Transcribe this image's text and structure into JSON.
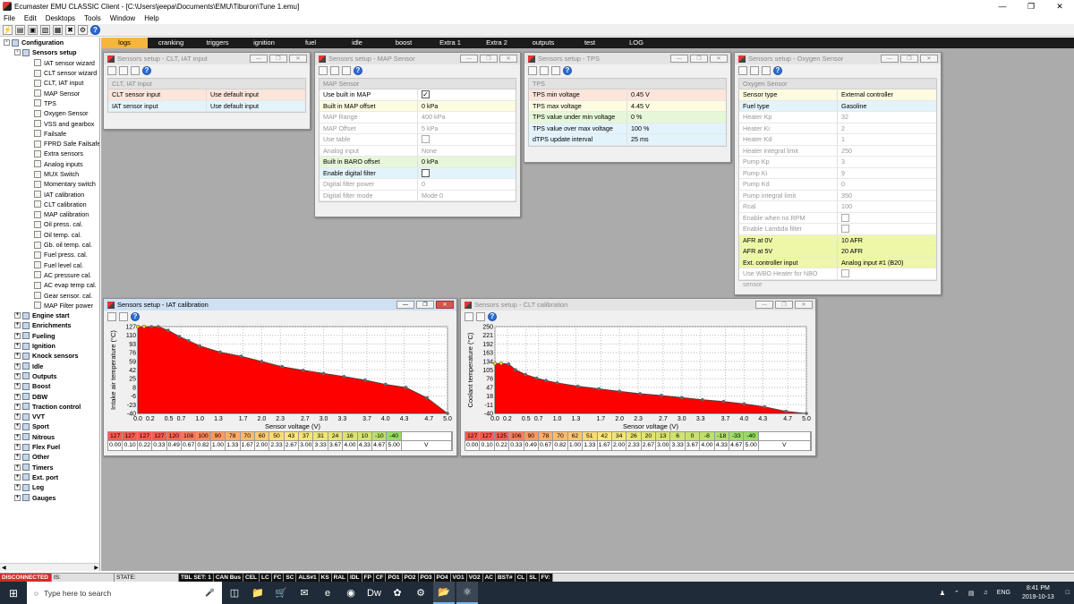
{
  "app": {
    "title": "Ecumaster EMU CLASSIC Client - [C:\\Users\\jeepa\\Documents\\EMU\\Tiburon\\Tune 1.emu]"
  },
  "menu": [
    "File",
    "Edit",
    "Desktops",
    "Tools",
    "Window",
    "Help"
  ],
  "tree": {
    "root": "Configuration",
    "sensors_setup": "Sensors setup",
    "children": [
      "IAT sensor wizard",
      "CLT sensor wizard",
      "CLT, IAT input",
      "MAP Sensor",
      "TPS",
      "Oxygen Sensor",
      "VSS and gearbox",
      "Failsafe",
      "FPRD Safe Failsafe",
      "Extra sensors",
      "Analog inputs",
      "MUX Switch",
      "Momentary switch",
      "IAT calibration",
      "CLT calibration",
      "MAP calibration",
      "Oil press. cal.",
      "Oil temp. cal.",
      "Gb. oil temp. cal.",
      "Fuel press. cal.",
      "Fuel level cal.",
      "AC pressure cal.",
      "AC evap temp cal.",
      "Gear sensor. cal.",
      "MAP Filter power"
    ],
    "groups": [
      "Engine start",
      "Enrichments",
      "Fueling",
      "Ignition",
      "Knock sensors",
      "Idle",
      "Outputs",
      "Boost",
      "DBW",
      "Traction control",
      "VVT",
      "Sport",
      "Nitrous",
      "Flex Fuel",
      "Other",
      "Timers",
      "Ext. port",
      "Log",
      "Gauges"
    ]
  },
  "tabs": [
    "logs",
    "cranking",
    "triggers",
    "ignition",
    "fuel",
    "idle",
    "boost",
    "Extra 1",
    "Extra 2",
    "outputs",
    "test",
    "LOG"
  ],
  "active_tab": "logs",
  "clt_iat_window": {
    "title": "Sensors setup - CLT, IAT input",
    "header": "CLT, IAT Input",
    "rows": [
      {
        "k": "CLT sensor input",
        "v": "Use default input"
      },
      {
        "k": "IAT sensor input",
        "v": "Use default input"
      }
    ]
  },
  "map_window": {
    "title": "Sensors setup - MAP Sensor",
    "header": "MAP Sensor",
    "rows": [
      {
        "k": "Use built in MAP",
        "v": "",
        "checkbox": true,
        "checked": true
      },
      {
        "k": "Built in MAP offset",
        "v": "0 kPa"
      },
      {
        "k": "MAP Range",
        "v": "400 kPa",
        "dim": true
      },
      {
        "k": "MAP Offset",
        "v": "5 kPa",
        "dim": true
      },
      {
        "k": "Use table",
        "v": "",
        "checkbox": true,
        "checked": false,
        "dim": true
      },
      {
        "k": "Analog input",
        "v": "None",
        "dim": true
      },
      {
        "k": "Built in BARO offset",
        "v": "0 kPa"
      },
      {
        "k": "Enable digital filter",
        "v": "",
        "checkbox": true,
        "checked": false
      },
      {
        "k": "Digital filter power",
        "v": "0",
        "dim": true
      },
      {
        "k": "Digital filter mode",
        "v": "Mode 0",
        "dim": true
      }
    ]
  },
  "tps_window": {
    "title": "Sensors setup - TPS",
    "header": "TPS",
    "rows": [
      {
        "k": "TPS min voltage",
        "v": "0.45 V"
      },
      {
        "k": "TPS max voltage",
        "v": "4.45 V"
      },
      {
        "k": "TPS value under min voltage",
        "v": "0 %"
      },
      {
        "k": "TPS value over  max voltage",
        "v": "100 %"
      },
      {
        "k": "dTPS update interval",
        "v": "25 ms"
      }
    ]
  },
  "o2_window": {
    "title": "Sensors setup - Oxygen Sensor",
    "header": "Oxygen Sensor",
    "rows": [
      {
        "k": "Sensor type",
        "v": "External controller"
      },
      {
        "k": "Fuel type",
        "v": "Gasoline"
      },
      {
        "k": "Heater Kp",
        "v": "32",
        "dim": true
      },
      {
        "k": "Heater Ki",
        "v": "2",
        "dim": true
      },
      {
        "k": "Heater Kd",
        "v": "1",
        "dim": true
      },
      {
        "k": "Heater integral limit",
        "v": "250",
        "dim": true
      },
      {
        "k": "Pump Kp",
        "v": "3",
        "dim": true
      },
      {
        "k": "Pump Ki",
        "v": "9",
        "dim": true
      },
      {
        "k": "Pump Kd",
        "v": "0",
        "dim": true
      },
      {
        "k": "Pump integral limit",
        "v": "350",
        "dim": true
      },
      {
        "k": "Rcal",
        "v": "100",
        "dim": true
      },
      {
        "k": "Enable when no RPM",
        "v": "",
        "checkbox": true,
        "checked": false,
        "dim": true
      },
      {
        "k": "Enable Lambda filter",
        "v": "",
        "checkbox": true,
        "checked": false,
        "dim": true
      },
      {
        "k": "AFR at 0V",
        "v": "10 AFR"
      },
      {
        "k": "AFR at 5V",
        "v": "20 AFR"
      },
      {
        "k": "Ext. controller input",
        "v": "Analog input #1 (B20)"
      },
      {
        "k": "Use WBO Heater for NBO sensor",
        "v": "",
        "checkbox": true,
        "checked": false,
        "dim": true
      }
    ]
  },
  "iat_window": {
    "title": "Sensors setup - IAT calibration",
    "top_row": [
      "127",
      "127",
      "127",
      "127",
      "120",
      "108",
      "100",
      "90",
      "78",
      "70",
      "60",
      "50",
      "43",
      "37",
      "31",
      "24",
      "16",
      "10",
      "-10",
      "-40",
      ""
    ],
    "bottom_row": [
      "0.00",
      "0.10",
      "0.22",
      "0.33",
      "0.49",
      "0.67",
      "0.82",
      "1.00",
      "1.33",
      "1.67",
      "2.00",
      "2.33",
      "2.67",
      "3.00",
      "3.33",
      "3.67",
      "4.00",
      "4.33",
      "4.67",
      "5.00",
      "V"
    ]
  },
  "clt_window": {
    "title": "Sensors setup - CLT calibration",
    "top_row": [
      "127",
      "127",
      "125",
      "106",
      "90",
      "78",
      "70",
      "62",
      "51",
      "42",
      "34",
      "26",
      "20",
      "13",
      "6",
      "0",
      "-8",
      "-18",
      "-33",
      "-40",
      ""
    ],
    "bottom_row": [
      "0.00",
      "0.10",
      "0.22",
      "0.33",
      "0.49",
      "0.67",
      "0.82",
      "1.00",
      "1.33",
      "1.67",
      "2.00",
      "2.33",
      "2.67",
      "3.00",
      "3.33",
      "3.67",
      "4.00",
      "4.33",
      "4.67",
      "5.00",
      "V"
    ]
  },
  "chart_data": [
    {
      "type": "area",
      "title": "",
      "xlabel": "Sensor voltage (V)",
      "ylabel": "Intake air temperature (°C)",
      "x": [
        0.0,
        0.1,
        0.22,
        0.33,
        0.49,
        0.67,
        0.82,
        1.0,
        1.33,
        1.67,
        2.0,
        2.33,
        2.67,
        3.0,
        3.33,
        3.67,
        4.0,
        4.33,
        4.67,
        5.0
      ],
      "y": [
        127,
        127,
        127,
        127,
        120,
        108,
        100,
        90,
        78,
        70,
        60,
        50,
        43,
        37,
        31,
        24,
        16,
        10,
        -10,
        -40
      ],
      "xticks": [
        "0.0",
        "0.2",
        "0.5",
        "0.7",
        "1.0",
        "1.3",
        "1.7",
        "2.0",
        "2.3",
        "2.7",
        "3.0",
        "3.3",
        "3.7",
        "4.0",
        "4.3",
        "4.7",
        "5.0"
      ],
      "xtick_vals": [
        0.0,
        0.2,
        0.5,
        0.7,
        1.0,
        1.3,
        1.7,
        2.0,
        2.3,
        2.7,
        3.0,
        3.3,
        3.7,
        4.0,
        4.3,
        4.7,
        5.0
      ],
      "yticks": [
        "127",
        "110",
        "93",
        "76",
        "59",
        "42",
        "25",
        "8",
        "-6",
        "-23",
        "-40"
      ],
      "ylim": [
        -40,
        127
      ],
      "xlim": [
        0,
        5
      ],
      "fill": "#ff0000"
    },
    {
      "type": "area",
      "title": "",
      "xlabel": "Sensor voltage (V)",
      "ylabel": "Coolant temperature (°C)",
      "x": [
        0.0,
        0.1,
        0.22,
        0.33,
        0.49,
        0.67,
        0.82,
        1.0,
        1.33,
        1.67,
        2.0,
        2.33,
        2.67,
        3.0,
        3.33,
        3.67,
        4.0,
        4.33,
        4.67,
        5.0
      ],
      "y": [
        127,
        127,
        125,
        106,
        90,
        78,
        70,
        62,
        51,
        42,
        34,
        26,
        20,
        13,
        6,
        0,
        -8,
        -18,
        -33,
        -40
      ],
      "xticks": [
        "0.0",
        "0.2",
        "0.5",
        "0.7",
        "1.0",
        "1.3",
        "1.7",
        "2.0",
        "2.3",
        "2.7",
        "3.0",
        "3.3",
        "3.7",
        "4.0",
        "4.3",
        "4.7",
        "5.0"
      ],
      "xtick_vals": [
        0.0,
        0.2,
        0.5,
        0.7,
        1.0,
        1.3,
        1.7,
        2.0,
        2.3,
        2.7,
        3.0,
        3.3,
        3.7,
        4.0,
        4.3,
        4.7,
        5.0
      ],
      "yticks": [
        "250",
        "221",
        "192",
        "163",
        "134",
        "105",
        "76",
        "47",
        "18",
        "-11",
        "-40"
      ],
      "ylim": [
        -40,
        250
      ],
      "xlim": [
        0,
        5
      ],
      "fill": "#ff0000"
    }
  ],
  "status": [
    "DISCONNECTED",
    "IS:",
    "STATE:",
    "TBL SET: 1",
    "CAN Bus",
    "CEL",
    "LC",
    "FC",
    "SC",
    "ALS#1",
    "KS",
    "RAL",
    "IDL",
    "FP",
    "CF",
    "PO1",
    "PO2",
    "PO3",
    "PO4",
    "VO1",
    "VO2",
    "AC",
    "BST#",
    "CL",
    "SL",
    "FV:"
  ],
  "taskbar": {
    "search_placeholder": "Type here to search",
    "lang": "ENG",
    "time": "8:41 PM",
    "date": "2019-10-13"
  }
}
